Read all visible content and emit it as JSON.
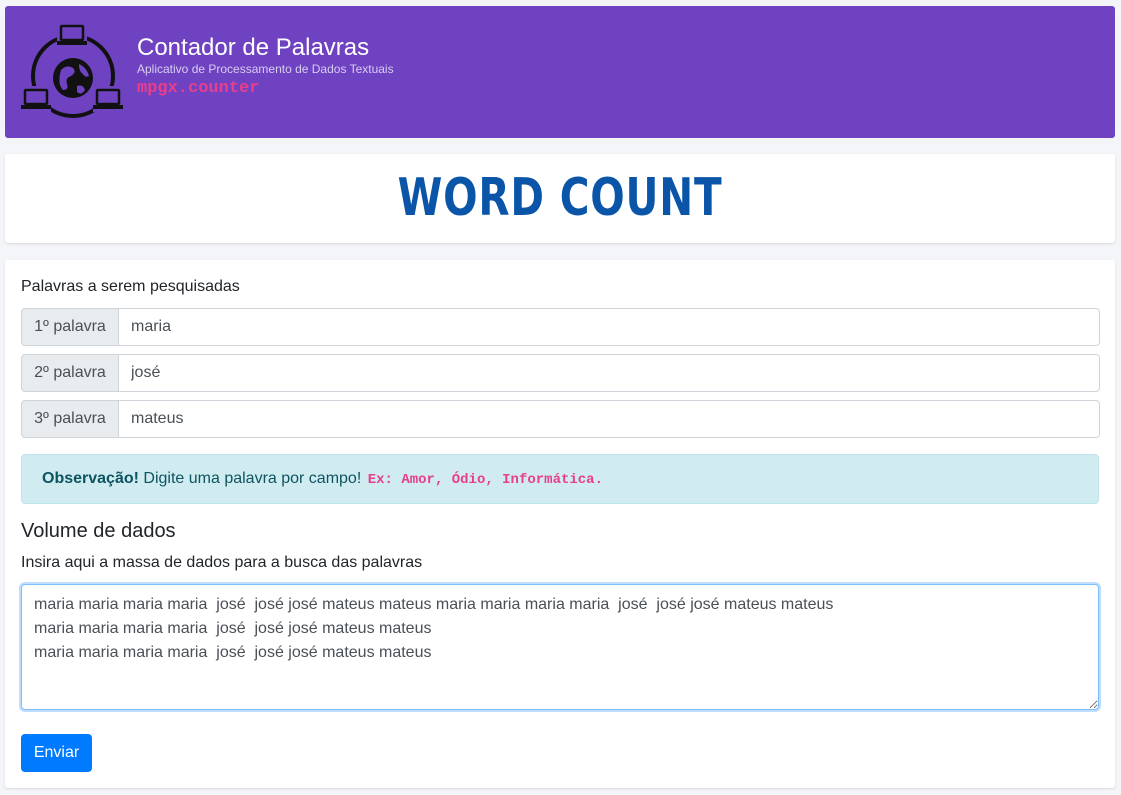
{
  "header": {
    "title": "Contador de Palavras",
    "subtitle": "Aplicativo de Processamento de Dados Textuais",
    "codename": "mpgx.counter",
    "logo_icon": "network-globe-icon",
    "bg_color": "#6f42c1"
  },
  "banner": {
    "text": "WORD COUNT",
    "color": "#0b55a8"
  },
  "form": {
    "words_label": "Palavras a serem pesquisadas",
    "fields": [
      {
        "prefix": "1º palavra",
        "value": "maria"
      },
      {
        "prefix": "2º palavra",
        "value": "josé"
      },
      {
        "prefix": "3º palavra",
        "value": "mateus"
      }
    ],
    "note": {
      "strong": "Observação!",
      "text": "Digite uma palavra por campo!",
      "example": "Ex: Amor, Ódio, Informática."
    },
    "volume_title": "Volume de dados",
    "volume_label": "Insira aqui a massa de dados para a busca das palavras",
    "textarea_value": "maria maria maria maria  josé  josé josé mateus mateus maria maria maria maria  josé  josé josé mateus mateus\nmaria maria maria maria  josé  josé josé mateus mateus\nmaria maria maria maria  josé  josé josé mateus mateus",
    "submit_label": "Enviar"
  },
  "colors": {
    "primary": "#007bff",
    "info_bg": "#d1ecf1",
    "code": "#e83e8c"
  }
}
